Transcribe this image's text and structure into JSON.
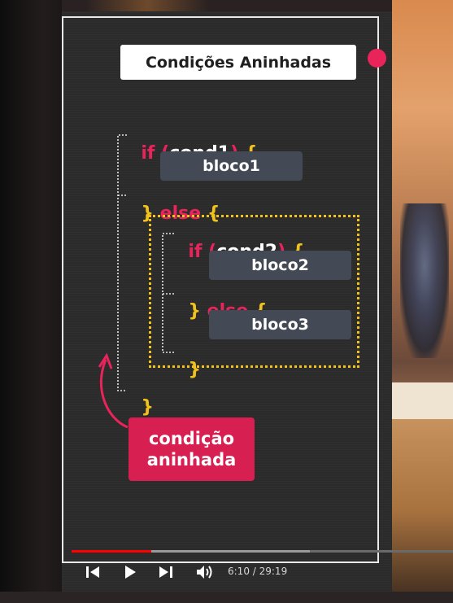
{
  "slide": {
    "title": "Condições Aninhadas",
    "code": {
      "if1_kw": "if",
      "cond1_open": "(",
      "cond1": "cond1",
      "cond1_close": ")",
      "open1": "{",
      "bloco1": "bloco1",
      "close1": "}",
      "else1_kw": "else",
      "open2": "{",
      "if2_kw": "if",
      "cond2_open": "(",
      "cond2": "cond2",
      "cond2_close": ")",
      "open3": "{",
      "bloco2": "bloco2",
      "close3": "}",
      "else2_kw": "else",
      "open4": "{",
      "bloco3": "bloco3",
      "close4": "}",
      "close2": "}"
    },
    "badge_line1": "condição",
    "badge_line2": "aninhada"
  },
  "player": {
    "time": "6:10 / 29:19",
    "progress_played_fraction": 0.21,
    "progress_buffered_fraction": 0.625
  },
  "icons": {
    "prev": "skip-previous-icon",
    "play": "play-icon",
    "next": "skip-next-icon",
    "volume": "volume-icon"
  },
  "colors": {
    "keyword": "#e8245a",
    "brace": "#f2c21b",
    "block_bg": "#444a55",
    "badge": "#d81f51",
    "progress": "#ff0000"
  }
}
